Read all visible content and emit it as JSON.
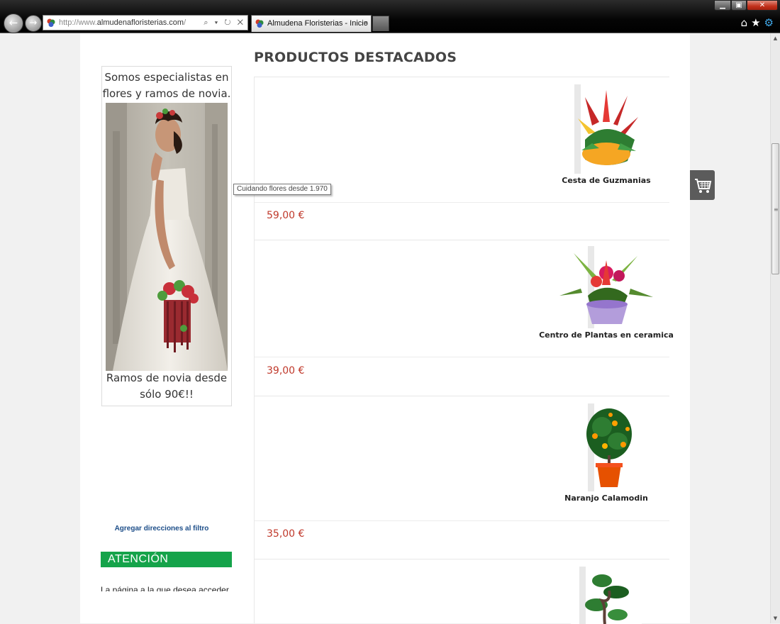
{
  "browser": {
    "address": {
      "prefix": "http://www.",
      "domain": "almudenafloristerias.com",
      "suffix": "/",
      "tools": "⌕ ▾ ↻ ✕"
    },
    "tab": {
      "title": "Almudena Floristerias - Inicio",
      "close": "×"
    },
    "nav": {
      "back": "←",
      "forward": "→"
    },
    "window": {
      "minimize": "▁",
      "maximize": "▣",
      "close": "✕"
    },
    "tools": {
      "home": "⌂",
      "favorites": "★",
      "settings": "⚙"
    }
  },
  "sidebar": {
    "promo_top": "Somos especialistas en flores y ramos de novia.",
    "promo_bottom": "Ramos de novia desde sólo 90€!!",
    "add_filter_link": "Agregar direcciones al filtro",
    "atencion_heading": "ATENCIÓN",
    "atencion_text": "La página a la que desea acceder"
  },
  "tooltip": "Cuidando flores desde 1.970",
  "main": {
    "title": "PRODUCTOS DESTACADOS",
    "products": [
      {
        "name": "Cesta de Guzmanias",
        "price": "59,00 €"
      },
      {
        "name": "Centro de Plantas en ceramica",
        "price": "39,00 €"
      },
      {
        "name": "Naranjo Calamodin",
        "price": "35,00 €"
      },
      {
        "name": "",
        "price": ""
      }
    ]
  },
  "colors": {
    "price": "#c0392b",
    "atencion": "#15a34a",
    "link": "#1d4e89",
    "cart": "#5b5b5b"
  },
  "icons": [
    "back-icon",
    "forward-icon",
    "home-icon",
    "star-icon",
    "gear-icon",
    "cart-icon"
  ]
}
